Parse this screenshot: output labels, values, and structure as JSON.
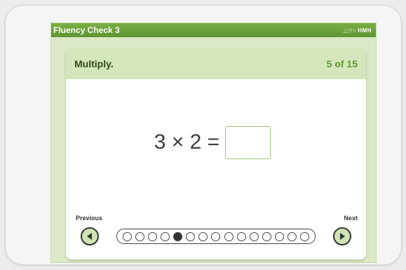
{
  "window": {
    "title": "Fluency Check 3",
    "brand": "HMH",
    "brand_marks": "△▽○"
  },
  "question": {
    "instruction": "Multiply.",
    "counter": "5 of 15",
    "expression": "3 × 2 =",
    "answer_value": ""
  },
  "navigation": {
    "previous_label": "Previous",
    "next_label": "Next"
  },
  "progress": {
    "total": 15,
    "current": 5
  },
  "colors": {
    "titlebar": "#6aa33b",
    "screen_bg": "#dbe9c6",
    "header_bg": "#d5e6bd",
    "counter": "#5c9c2c"
  }
}
